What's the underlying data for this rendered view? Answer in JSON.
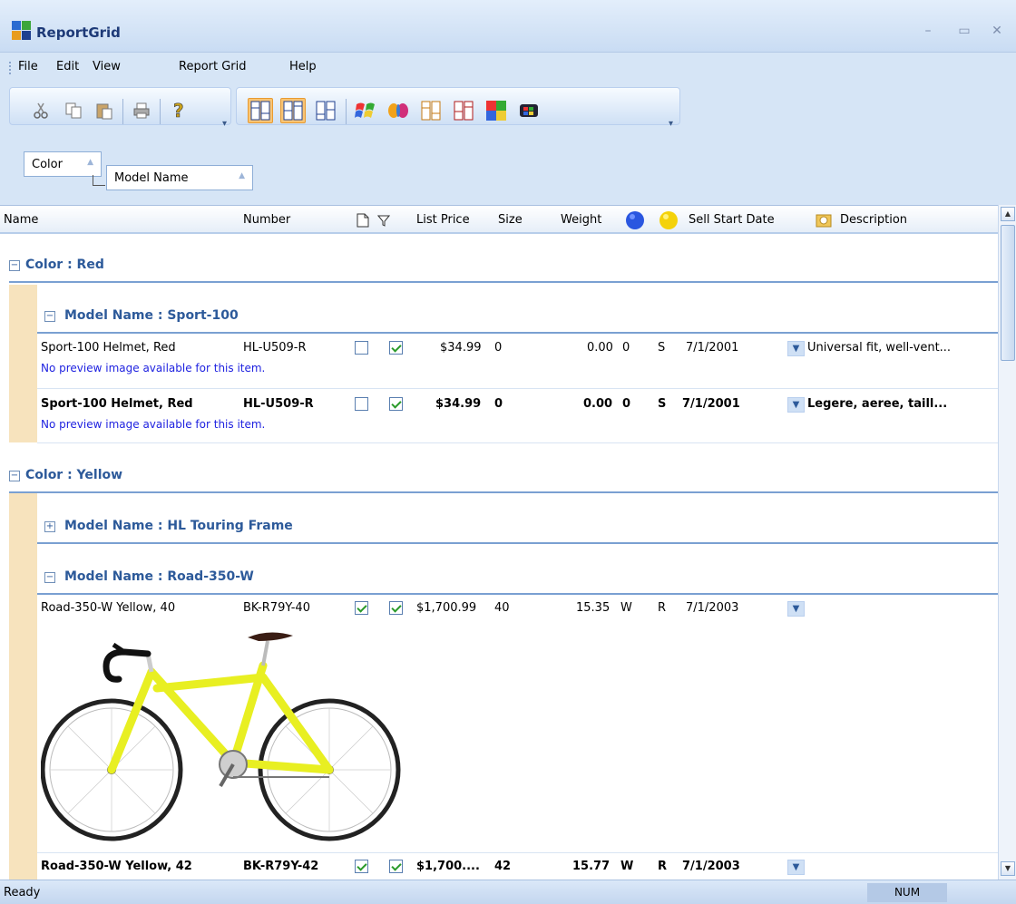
{
  "window": {
    "title": "ReportGrid"
  },
  "menu": [
    "File",
    "Edit",
    "View",
    "Report Grid",
    "Help"
  ],
  "toolbar": {
    "icons": [
      "cut-icon",
      "copy-icon",
      "paste-icon",
      "print-icon",
      "help-icon",
      "grid-style-1-icon",
      "grid-style-2-icon",
      "grid-style-3-icon",
      "xp-theme-icon",
      "butterfly-icon",
      "grid-style-4-icon",
      "grid-style-5-icon",
      "colorful-grid-icon",
      "windows-logo-icon"
    ]
  },
  "group_by": [
    "Color",
    "Model Name"
  ],
  "columns": {
    "name": "Name",
    "number": "Number",
    "list_price": "List Price",
    "size": "Size",
    "weight": "Weight",
    "sell_start_date": "Sell Start Date",
    "description": "Description"
  },
  "groups": {
    "red": "Color : Red",
    "sport100": "Model Name : Sport-100",
    "yellow": "Color : Yellow",
    "hl_touring": "Model Name : HL Touring Frame",
    "road350": "Model Name : Road-350-W"
  },
  "preview_text": "No preview image available for this item.",
  "rows": [
    {
      "name": "Sport-100 Helmet, Red",
      "number": "HL-U509-R",
      "price": "$34.99",
      "size": "0",
      "weight": "0.00",
      "weight_unit": "0",
      "class": "S",
      "date": "7/1/2001",
      "description": "Universal fit, well-vent..."
    },
    {
      "name": "Sport-100 Helmet, Red",
      "number": "HL-U509-R",
      "price": "$34.99",
      "size": "0",
      "weight": "0.00",
      "weight_unit": "0",
      "class": "S",
      "date": "7/1/2001",
      "description": "Legere, aeree, taill..."
    },
    {
      "name": "Road-350-W Yellow, 40",
      "number": "BK-R79Y-40",
      "price": "$1,700.99",
      "size": "40",
      "weight": "15.35",
      "weight_unit": "W",
      "class": "R",
      "date": "7/1/2003",
      "description": ""
    },
    {
      "name": "Road-350-W Yellow, 42",
      "number": "BK-R79Y-42",
      "price": "$1,700....",
      "size": "42",
      "weight": "15.77",
      "weight_unit": "W",
      "class": "R",
      "date": "7/1/2003",
      "description": ""
    }
  ],
  "status": {
    "text": "Ready",
    "num": "NUM"
  },
  "colors": {
    "accent": "#2d5a9a",
    "indent": "#f7e3bd",
    "bike": "#e8ef22"
  }
}
